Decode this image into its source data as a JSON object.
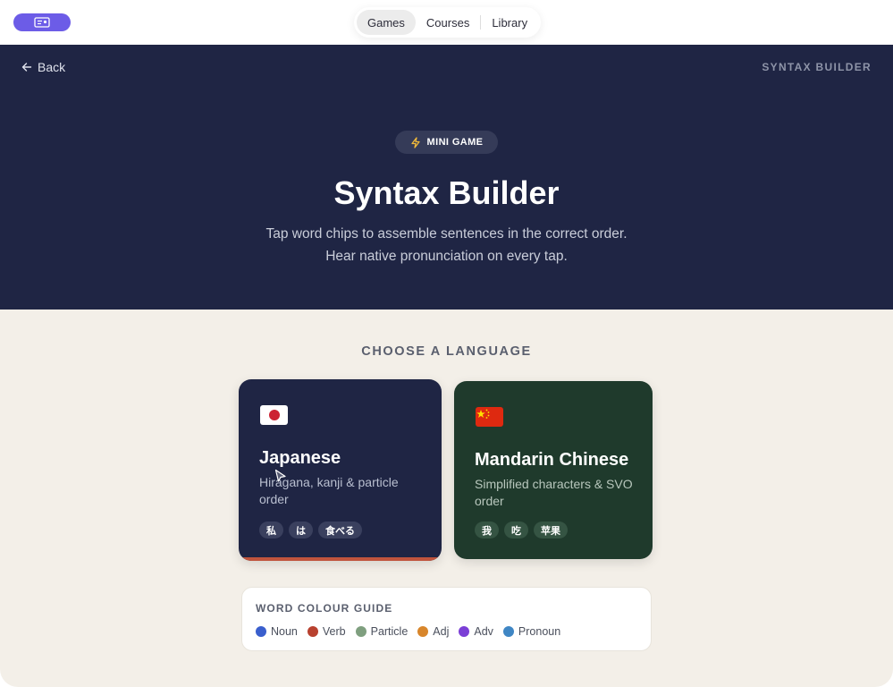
{
  "nav": {
    "tabs": [
      {
        "label": "Games",
        "active": true
      },
      {
        "label": "Courses",
        "active": false
      },
      {
        "label": "Library",
        "active": false
      }
    ]
  },
  "hero": {
    "back_label": "Back",
    "section_label": "SYNTAX BUILDER",
    "badge": "MINI GAME",
    "title": "Syntax Builder",
    "subtitle_line1": "Tap word chips to assemble sentences in the correct order.",
    "subtitle_line2": "Hear native pronunciation on every tap."
  },
  "choose_label": "CHOOSE A LANGUAGE",
  "languages": [
    {
      "name": "Japanese",
      "description": "Hiragana, kanji & particle order",
      "flag": "japan-flag-icon",
      "chips": [
        "私",
        "は",
        "食べる"
      ],
      "selected": true
    },
    {
      "name": "Mandarin Chinese",
      "description": "Simplified characters & SVO order",
      "flag": "china-flag-icon",
      "chips": [
        "我",
        "吃",
        "苹果"
      ],
      "selected": false
    }
  ],
  "guide": {
    "title": "WORD COLOUR GUIDE",
    "items": [
      {
        "label": "Noun",
        "color": "#3a5fcd"
      },
      {
        "label": "Verb",
        "color": "#b8412f"
      },
      {
        "label": "Particle",
        "color": "#7f9f7f"
      },
      {
        "label": "Adj",
        "color": "#d8862b"
      },
      {
        "label": "Adv",
        "color": "#7b3fd6"
      },
      {
        "label": "Pronoun",
        "color": "#3f86c4"
      }
    ]
  },
  "colors": {
    "hero_bg": "#1f2544",
    "content_bg": "#f3efe8",
    "accent": "#6c5ce7",
    "japanese_card": "#1f2544",
    "mandarin_card": "#1f3a2c",
    "selected_underline": "#c0543d"
  }
}
